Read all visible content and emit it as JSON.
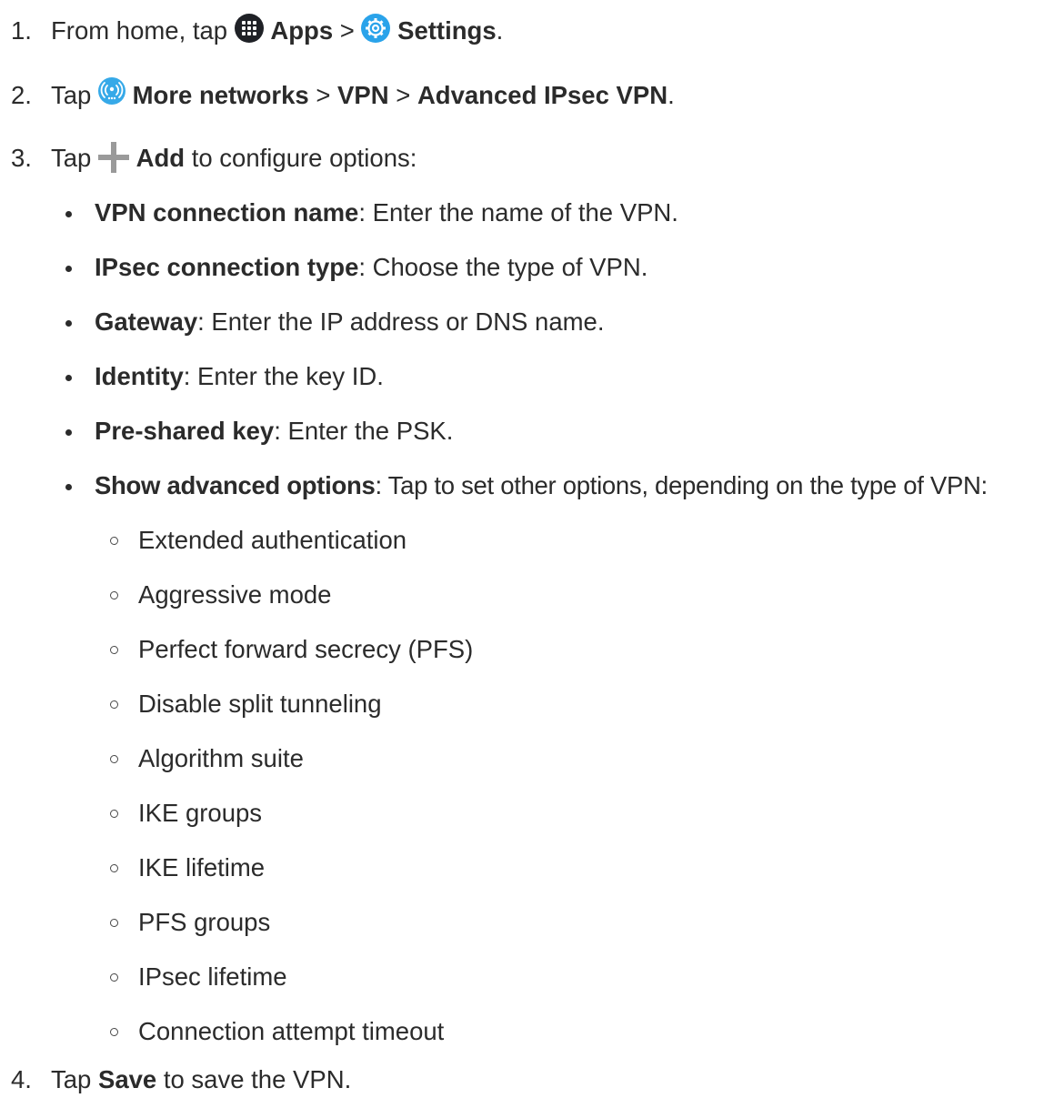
{
  "steps": [
    {
      "number": "1.",
      "parts": {
        "a": "From home, tap ",
        "apps": "Apps",
        "sep": " > ",
        "settings": "Settings",
        "end": "."
      }
    },
    {
      "number": "2.",
      "parts": {
        "a": "Tap ",
        "more": "More networks",
        "sep1": " > ",
        "vpn": "VPN",
        "sep2": " > ",
        "adv": "Advanced IPsec VPN",
        "end": "."
      }
    },
    {
      "number": "3.",
      "parts": {
        "a": "Tap ",
        "add": "Add",
        "rest": " to configure options:"
      }
    },
    {
      "number": "4.",
      "parts": {
        "a": "Tap ",
        "save": "Save",
        "rest": " to save the VPN."
      }
    }
  ],
  "options": [
    {
      "label": "VPN connection name",
      "desc": ": Enter the name of the VPN."
    },
    {
      "label": "IPsec connection type",
      "desc": ": Choose the type of VPN."
    },
    {
      "label": "Gateway",
      "desc": ": Enter the IP address or DNS name."
    },
    {
      "label": "Identity",
      "desc": ": Enter the key ID."
    },
    {
      "label": "Pre-shared key",
      "desc": ": Enter the PSK."
    },
    {
      "label": "Show advanced options",
      "desc": ": Tap to set other options, depending on the type of VPN:"
    }
  ],
  "advanced_options": [
    "Extended authentication",
    "Aggressive mode",
    "Perfect forward secrecy (PFS)",
    "Disable split tunneling",
    "Algorithm suite",
    "IKE groups",
    "IKE lifetime",
    "PFS groups",
    "IPsec lifetime",
    "Connection attempt timeout"
  ],
  "icons": {
    "apps": "apps-grid-icon",
    "settings": "settings-gear-icon",
    "more_networks": "more-networks-icon",
    "add": "plus-icon"
  },
  "colors": {
    "text": "#2b2b2b",
    "settings_icon": "#2aa3ea",
    "networks_icon": "#36a9e8",
    "apps_icon": "#1f2126",
    "plus_icon": "#9a9a9a"
  }
}
